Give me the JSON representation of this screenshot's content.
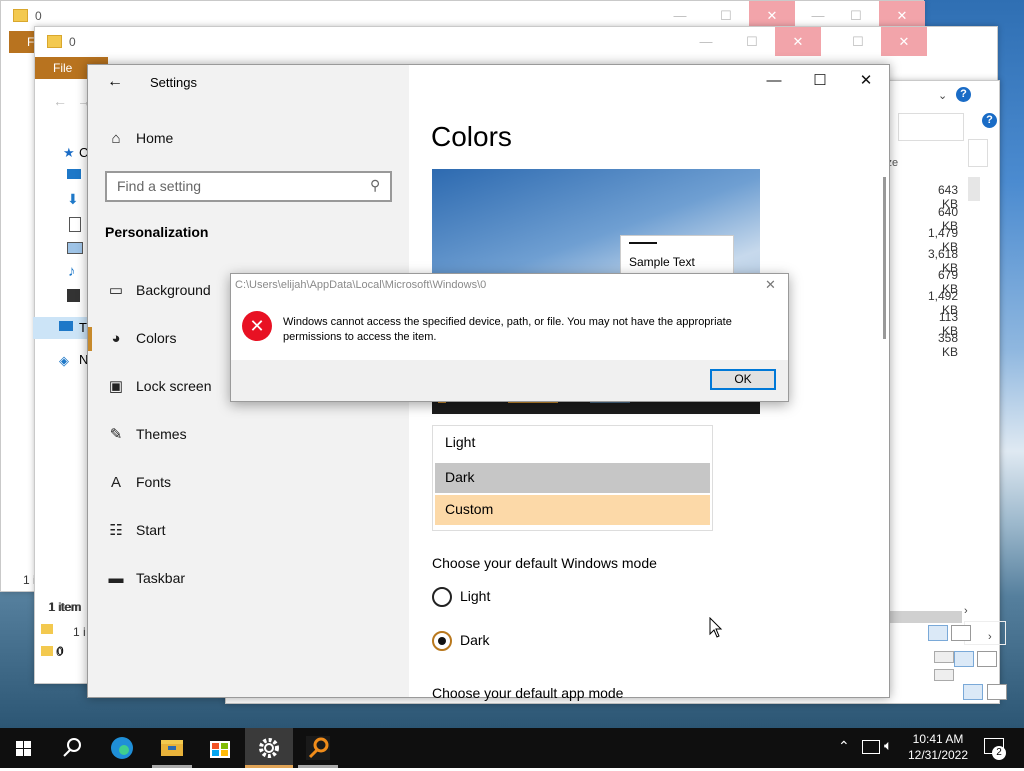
{
  "explorer": {
    "window_titles": [
      "0",
      "0"
    ],
    "file_tab": "File",
    "sidebar_truncated": [
      "C",
      "T",
      "N"
    ],
    "sizes_header": "ize",
    "sizes": [
      "643 KB",
      "640 KB",
      "1,479 KB",
      "3,618 KB",
      "679 KB",
      "1,492 KB",
      "113 KB",
      "358 KB"
    ],
    "status_items": [
      "1 item",
      "1 i",
      "1 i"
    ],
    "bottom_rows": [
      "0",
      "0"
    ],
    "help": "?"
  },
  "settings": {
    "window_title": "Settings",
    "back_glyph": "←",
    "minimize_glyph": "—",
    "maximize_glyph": "☐",
    "close_glyph": "✕",
    "home_label": "Home",
    "search_placeholder": "Find a setting",
    "section_heading": "Personalization",
    "nav": [
      {
        "label": "Background",
        "icon": "picture-icon",
        "glyph": "▭"
      },
      {
        "label": "Colors",
        "icon": "palette-icon",
        "glyph": "◕"
      },
      {
        "label": "Lock screen",
        "icon": "lock-screen-icon",
        "glyph": "▣"
      },
      {
        "label": "Themes",
        "icon": "themes-icon",
        "glyph": "✎"
      },
      {
        "label": "Fonts",
        "icon": "fonts-icon",
        "glyph": "A"
      },
      {
        "label": "Start",
        "icon": "start-icon",
        "glyph": "☷"
      },
      {
        "label": "Taskbar",
        "icon": "taskbar-icon",
        "glyph": "▬"
      }
    ],
    "selected_nav": "Colors",
    "page_title": "Colors",
    "preview_sample_text": "Sample Text",
    "color_options": [
      "Light",
      "Dark",
      "Custom"
    ],
    "windows_mode_heading": "Choose your default Windows mode",
    "windows_mode_options": [
      "Light",
      "Dark"
    ],
    "windows_mode_selected": "Dark",
    "app_mode_heading": "Choose your default app mode"
  },
  "dialog": {
    "title": "C:\\Users\\elijah\\AppData\\Local\\Microsoft\\Windows\\0",
    "message": "Windows cannot access the specified device, path, or file. You may not have the appropriate permissions to access the item.",
    "ok_label": "OK",
    "close_glyph": "✕"
  },
  "taskbar": {
    "time": "10:41 AM",
    "date": "12/31/2022",
    "notification_count": "2",
    "apps": [
      "start",
      "search",
      "edge",
      "file-explorer",
      "store",
      "settings",
      "search-app"
    ]
  },
  "colors": {
    "accent": "#c78a2c",
    "custom_highlight": "#fcd9a8",
    "dark_highlight": "#c6c6c6",
    "error_red": "#e81123"
  }
}
